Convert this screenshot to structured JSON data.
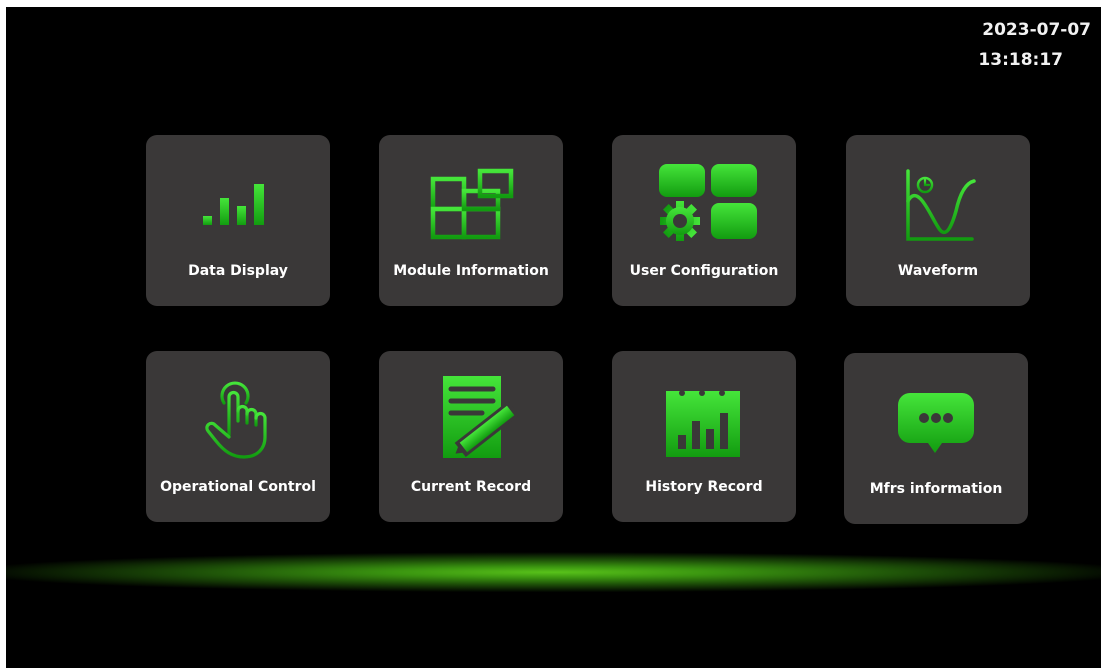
{
  "clock": {
    "date": "2023-07-07",
    "time": "13:18:17"
  },
  "colors": {
    "accent": "#2fc81e",
    "tile": "#3a3838",
    "background": "#000000"
  },
  "tiles": [
    {
      "label": "Data Display",
      "icon": "bar-chart-icon"
    },
    {
      "label": "Module Information",
      "icon": "module-grid-icon"
    },
    {
      "label": "User Configuration",
      "icon": "settings-blocks-icon"
    },
    {
      "label": "Waveform",
      "icon": "waveform-icon"
    },
    {
      "label": "Operational Control",
      "icon": "pointing-hand-icon"
    },
    {
      "label": "Current  Record",
      "icon": "edit-document-icon"
    },
    {
      "label": "History Record",
      "icon": "calendar-chart-icon"
    },
    {
      "label": "Mfrs information",
      "icon": "chat-bubble-icon"
    }
  ]
}
